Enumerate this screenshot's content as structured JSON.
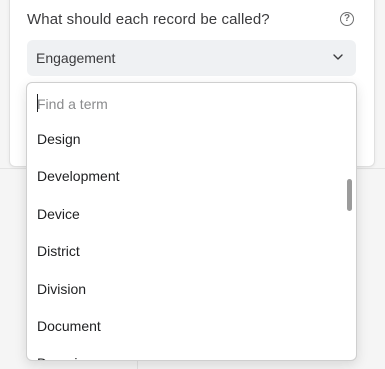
{
  "prompt": {
    "question": "What should each record be called?",
    "help_glyph": "?"
  },
  "select": {
    "value": "Engagement",
    "icon": "chevron-down-icon"
  },
  "dropdown": {
    "search_placeholder": "Find a term",
    "items": [
      "Design",
      "Development",
      "Device",
      "District",
      "Division",
      "Document",
      "Domain"
    ]
  },
  "colors": {
    "background": "#f5f5f5",
    "surface": "#ffffff",
    "select_fill": "#eff1f3",
    "text": "#1e1f21",
    "muted_text": "#3b3b3d",
    "placeholder": "#8a8b8d",
    "scroll_thumb": "#9b9b9b"
  }
}
